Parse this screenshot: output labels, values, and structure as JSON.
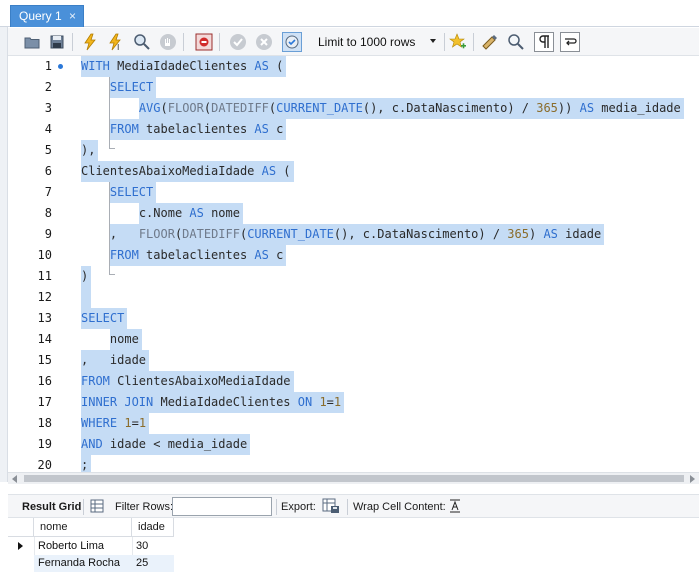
{
  "tab": {
    "title": "Query 1",
    "close_glyph": "×"
  },
  "toolbar": {
    "icons": [
      "open-sql-icon",
      "save-icon",
      "execute-icon",
      "execute-current-icon",
      "explain-icon",
      "stop-icon",
      "toggle-error-icon",
      "commit-icon",
      "rollback-icon",
      "autocommit-icon",
      "beautify-icon",
      "find-icon",
      "invisible-chars-icon",
      "wrap-icon",
      "favorite-icon"
    ],
    "limit_label": "Limit to 1000 rows"
  },
  "editor": {
    "line_numbers": [
      "1",
      "2",
      "3",
      "4",
      "5",
      "6",
      "7",
      "8",
      "9",
      "10",
      "11",
      "12",
      "13",
      "14",
      "15",
      "16",
      "17",
      "18",
      "19",
      "20"
    ],
    "lines": [
      {
        "indent": 0,
        "tokens": [
          [
            "kw",
            "WITH"
          ],
          [
            "id",
            " MediaIdadeClientes "
          ],
          [
            "kw",
            "AS"
          ],
          [
            "op",
            " ("
          ]
        ]
      },
      {
        "indent": 4,
        "tokens": [
          [
            "kw",
            "SELECT"
          ]
        ]
      },
      {
        "indent": 8,
        "tokens": [
          [
            "kw",
            "AVG"
          ],
          [
            "op",
            "("
          ],
          [
            "fn",
            "FLOOR"
          ],
          [
            "op",
            "("
          ],
          [
            "fn",
            "DATEDIFF"
          ],
          [
            "op",
            "("
          ],
          [
            "kw",
            "CURRENT_DATE"
          ],
          [
            "op",
            "(), c.DataNascimento) / "
          ],
          [
            "num",
            "365"
          ],
          [
            "op",
            ")) "
          ],
          [
            "kw",
            "AS"
          ],
          [
            "id",
            " media_idade"
          ]
        ]
      },
      {
        "indent": 4,
        "tokens": [
          [
            "kw",
            "FROM"
          ],
          [
            "id",
            " tabelaclientes "
          ],
          [
            "kw",
            "AS"
          ],
          [
            "id",
            " c"
          ]
        ]
      },
      {
        "indent": 0,
        "tokens": [
          [
            "op",
            "),"
          ]
        ]
      },
      {
        "indent": 0,
        "tokens": [
          [
            "id",
            "ClientesAbaixoMediaIdade "
          ],
          [
            "kw",
            "AS"
          ],
          [
            "op",
            " ("
          ]
        ]
      },
      {
        "indent": 4,
        "tokens": [
          [
            "kw",
            "SELECT"
          ]
        ]
      },
      {
        "indent": 8,
        "tokens": [
          [
            "id",
            "c.Nome "
          ],
          [
            "kw",
            "AS"
          ],
          [
            "id",
            " nome"
          ]
        ]
      },
      {
        "indent": 4,
        "tokens": [
          [
            "op",
            ",   "
          ],
          [
            "fn",
            "FLOOR"
          ],
          [
            "op",
            "("
          ],
          [
            "fn",
            "DATEDIFF"
          ],
          [
            "op",
            "("
          ],
          [
            "kw",
            "CURRENT_DATE"
          ],
          [
            "op",
            "(), c.DataNascimento) / "
          ],
          [
            "num",
            "365"
          ],
          [
            "op",
            ") "
          ],
          [
            "kw",
            "AS"
          ],
          [
            "id",
            " idade"
          ]
        ]
      },
      {
        "indent": 4,
        "tokens": [
          [
            "kw",
            "FROM"
          ],
          [
            "id",
            " tabelaclientes "
          ],
          [
            "kw",
            "AS"
          ],
          [
            "id",
            " c"
          ]
        ]
      },
      {
        "indent": 0,
        "tokens": [
          [
            "op",
            ")"
          ]
        ]
      },
      {
        "indent": 0,
        "tokens": [
          [
            "op",
            " "
          ]
        ]
      },
      {
        "indent": 0,
        "tokens": [
          [
            "kw",
            "SELECT"
          ]
        ]
      },
      {
        "indent": 4,
        "tokens": [
          [
            "id",
            "nome"
          ]
        ]
      },
      {
        "indent": 0,
        "tokens": [
          [
            "op",
            ",   "
          ],
          [
            "id",
            "idade"
          ]
        ]
      },
      {
        "indent": 0,
        "tokens": [
          [
            "kw",
            "FROM"
          ],
          [
            "id",
            " ClientesAbaixoMediaIdade"
          ]
        ]
      },
      {
        "indent": 0,
        "tokens": [
          [
            "kw",
            "INNER JOIN"
          ],
          [
            "id",
            " MediaIdadeClientes "
          ],
          [
            "kw",
            "ON"
          ],
          [
            "op",
            " "
          ],
          [
            "num",
            "1"
          ],
          [
            "op",
            "="
          ],
          [
            "num",
            "1"
          ]
        ]
      },
      {
        "indent": 0,
        "tokens": [
          [
            "kw",
            "WHERE"
          ],
          [
            "op",
            " "
          ],
          [
            "num",
            "1"
          ],
          [
            "op",
            "="
          ],
          [
            "num",
            "1"
          ]
        ]
      },
      {
        "indent": 0,
        "tokens": [
          [
            "kw",
            "AND"
          ],
          [
            "id",
            " idade < media_idade"
          ]
        ]
      },
      {
        "indent": 0,
        "tokens": [
          [
            "op",
            ";"
          ]
        ]
      }
    ]
  },
  "results": {
    "result_grid_label": "Result Grid",
    "filter_label": "Filter Rows:",
    "filter_value": "",
    "export_label": "Export:",
    "wrap_label": "Wrap Cell Content:",
    "columns": [
      "nome",
      "idade"
    ],
    "rows": [
      {
        "nome": "Roberto Lima",
        "idade": "30"
      },
      {
        "nome": "Fernanda Rocha",
        "idade": "25"
      }
    ]
  },
  "colors": {
    "tab_active": "#4a90d9",
    "selection": "#c5dcf5",
    "keyword": "#2f6fcf",
    "function": "#6f7a8a",
    "number": "#8a6c2b"
  }
}
